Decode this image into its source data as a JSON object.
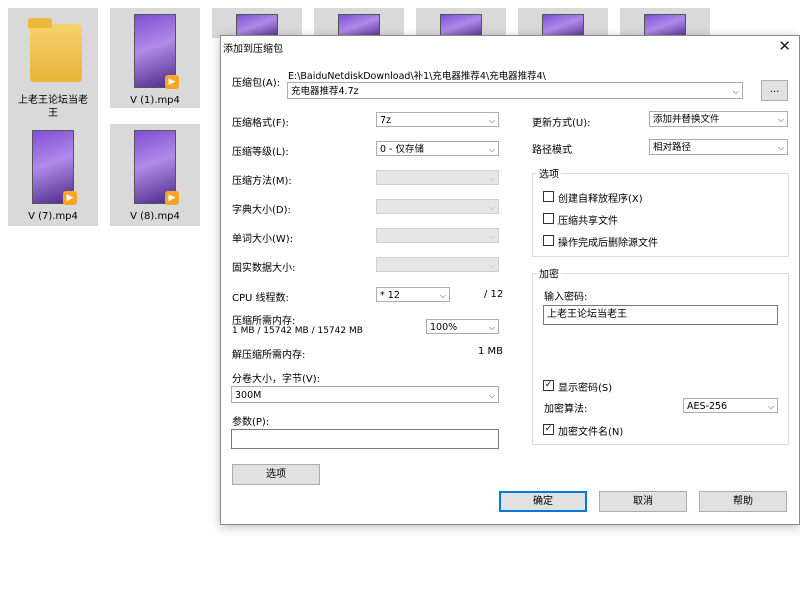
{
  "desktop": {
    "tiles": [
      {
        "name": "上老王论坛当老王",
        "type": "folder"
      },
      {
        "name": "V (1).mp4",
        "type": "video"
      },
      {
        "name": "",
        "type": "video"
      },
      {
        "name": "",
        "type": "video"
      },
      {
        "name": "",
        "type": "video"
      },
      {
        "name": "",
        "type": "video"
      },
      {
        "name": "",
        "type": "video"
      },
      {
        "name": "V (7).mp4",
        "type": "video"
      },
      {
        "name": "V (8).mp4",
        "type": "video"
      }
    ],
    "play_glyph": "▶"
  },
  "dialog": {
    "title": "添加到压缩包",
    "close_glyph": "✕",
    "archive_label": "压缩包(A):",
    "archive_path": "E:\\BaiduNetdiskDownload\\补1\\充电器推荐4\\充电器推荐4\\",
    "archive_name": "充电器推荐4.7z",
    "browse_label": "...",
    "format_label": "压缩格式(F):",
    "format_value": "7z",
    "level_label": "压缩等级(L):",
    "level_value": "0 - 仅存储",
    "method_label": "压缩方法(M):",
    "dict_label": "字典大小(D):",
    "word_label": "单词大小(W):",
    "solid_label": "固实数据大小:",
    "cpu_label": "CPU 线程数:",
    "cpu_value": "* 12",
    "cpu_total": "/ 12",
    "mem_comp_label": "压缩所需内存:",
    "mem_comp_value": "1 MB / 15742 MB / 15742 MB",
    "mem_comp_percent": "100%",
    "mem_decomp_label": "解压缩所需内存:",
    "mem_decomp_value": "1 MB",
    "split_label": "分卷大小，字节(V):",
    "split_value": "300M",
    "params_label": "参数(P):",
    "params_value": "",
    "options_btn": "选项",
    "update_label": "更新方式(U):",
    "update_value": "添加并替换文件",
    "path_label": "路径模式",
    "path_value": "相对路径",
    "options_group": "选项",
    "opt_sfx": "创建自释放程序(X)",
    "opt_shared": "压缩共享文件",
    "opt_delete": "操作完成后删除源文件",
    "encrypt_group": "加密",
    "password_label": "输入密码:",
    "password_value": "上老王论坛当老王",
    "show_password": "显示密码(S)",
    "encrypt_method_label": "加密算法:",
    "encrypt_method_value": "AES-256",
    "encrypt_names": "加密文件名(N)",
    "ok": "确定",
    "cancel": "取消",
    "help": "帮助",
    "dropdown_glyph": "⌵",
    "check_glyph": "✓"
  }
}
